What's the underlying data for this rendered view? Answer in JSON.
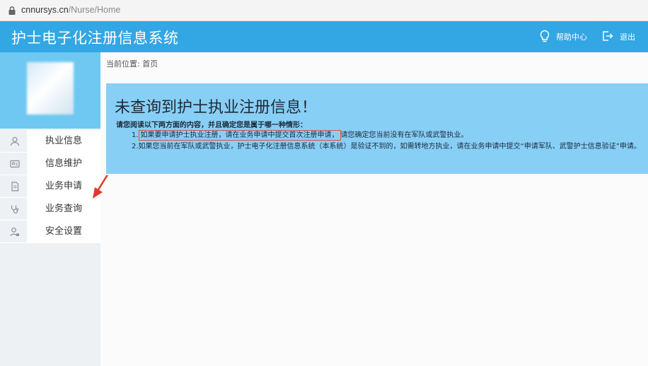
{
  "browser": {
    "url_domain": "cnnursys.cn",
    "url_path": "/Nurse/Home"
  },
  "header": {
    "title": "护士电子化注册信息系统",
    "help_label": "帮助中心",
    "logout_label": "退出"
  },
  "sidebar": {
    "items": [
      {
        "label": "执业信息",
        "icon": "user-icon"
      },
      {
        "label": "信息维护",
        "icon": "id-card-icon"
      },
      {
        "label": "业务申请",
        "icon": "document-icon"
      },
      {
        "label": "业务查询",
        "icon": "stethoscope-icon"
      },
      {
        "label": "安全设置",
        "icon": "user-lock-icon"
      }
    ]
  },
  "content": {
    "breadcrumb": "当前位置: 首页",
    "heading": "未查询到护士执业注册信息！",
    "intro": "请您阅读以下两方面的内容，并且确定您是属于哪一种情形：",
    "line1_prefix": "1.",
    "line1_highlight": "如果要申请护士执业注册，请在业务申请中提交首次注册申请，",
    "line1_suffix": "请您确定您当前没有在军队或武警执业。",
    "line2": "2.如果您当前在军队或武警执业，护士电子化注册信息系统（本系统）是验证不到的，如需转地方执业，请在业务申请中提交“申请军队、武警护士信息验证”申请。"
  },
  "colors": {
    "header": "#33a6e4",
    "avatar_panel": "#6fc8f1",
    "notice": "#88cff6",
    "highlight_box": "#d9544f",
    "arrow": "#e03a2f"
  }
}
